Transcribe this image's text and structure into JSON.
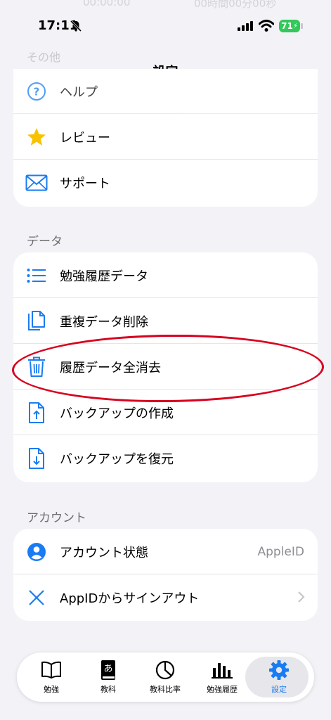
{
  "status_bar": {
    "time": "17:11",
    "battery": "71",
    "ghost_text_left": "00:00:00",
    "ghost_text_right": "00時間00分00秒"
  },
  "nav": {
    "title": "設定",
    "faded_section_header": "その他"
  },
  "other_section": {
    "items": [
      {
        "label": "ヘルプ",
        "icon": "help-circle-icon"
      },
      {
        "label": "レビュー",
        "icon": "star-icon"
      },
      {
        "label": "サポート",
        "icon": "envelope-icon"
      }
    ]
  },
  "data_section": {
    "header": "データ",
    "items": [
      {
        "label": "勉強履歴データ",
        "icon": "list-icon"
      },
      {
        "label": "重複データ削除",
        "icon": "duplicate-document-icon"
      },
      {
        "label": "履歴データ全消去",
        "icon": "trash-icon"
      },
      {
        "label": "バックアップの作成",
        "icon": "document-upload-icon"
      },
      {
        "label": "バックアップを復元",
        "icon": "document-download-icon"
      }
    ]
  },
  "account_section": {
    "header": "アカウント",
    "items": [
      {
        "label": "アカウント状態",
        "value": "AppleID",
        "icon": "person-circle-icon"
      },
      {
        "label": "AppIDからサインアウト",
        "icon": "x-mark-icon"
      }
    ]
  },
  "tab_bar": {
    "tabs": [
      {
        "label": "勉強",
        "icon": "book-icon"
      },
      {
        "label": "教科",
        "icon": "dictionary-icon"
      },
      {
        "label": "教科比率",
        "icon": "pie-chart-icon"
      },
      {
        "label": "勉強履歴",
        "icon": "bar-chart-icon"
      },
      {
        "label": "設定",
        "icon": "gear-icon",
        "active": true
      }
    ]
  },
  "colors": {
    "accent": "#1a7cf2",
    "star": "#f8c200",
    "highlight_circle": "#d7001e",
    "background": "#f2f2f7"
  }
}
